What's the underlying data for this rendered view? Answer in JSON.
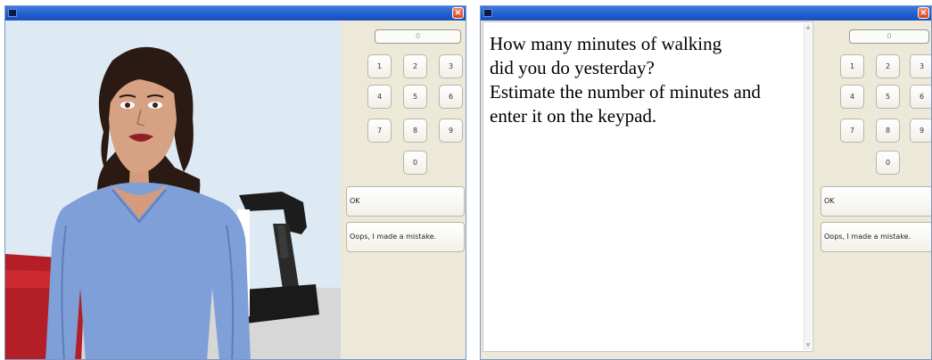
{
  "left_window": {
    "display_value": "0",
    "keys": [
      "1",
      "2",
      "3",
      "4",
      "5",
      "6",
      "7",
      "8",
      "9",
      "0"
    ],
    "ok_label": "OK",
    "mistake_label": "Oops, I made a mistake."
  },
  "right_window": {
    "question_lines": [
      "How many minutes of walking",
      "did you do yesterday?",
      "Estimate the number of minutes and",
      "enter it on the keypad."
    ],
    "display_value": "0",
    "keys": [
      "1",
      "2",
      "3",
      "4",
      "5",
      "6",
      "7",
      "8",
      "9",
      "0"
    ],
    "ok_label": "OK",
    "mistake_label": "Oops, I made a mistake."
  },
  "icons": {
    "close": "close-icon",
    "window": "window-icon"
  },
  "colors": {
    "titlebar": "#1f5ccc",
    "panel": "#ece9d8",
    "scene_background": "#dde9f3",
    "avatar_shirt": "#7f9fd8",
    "avatar_hair": "#2b1a14",
    "couch": "#b41e26"
  }
}
